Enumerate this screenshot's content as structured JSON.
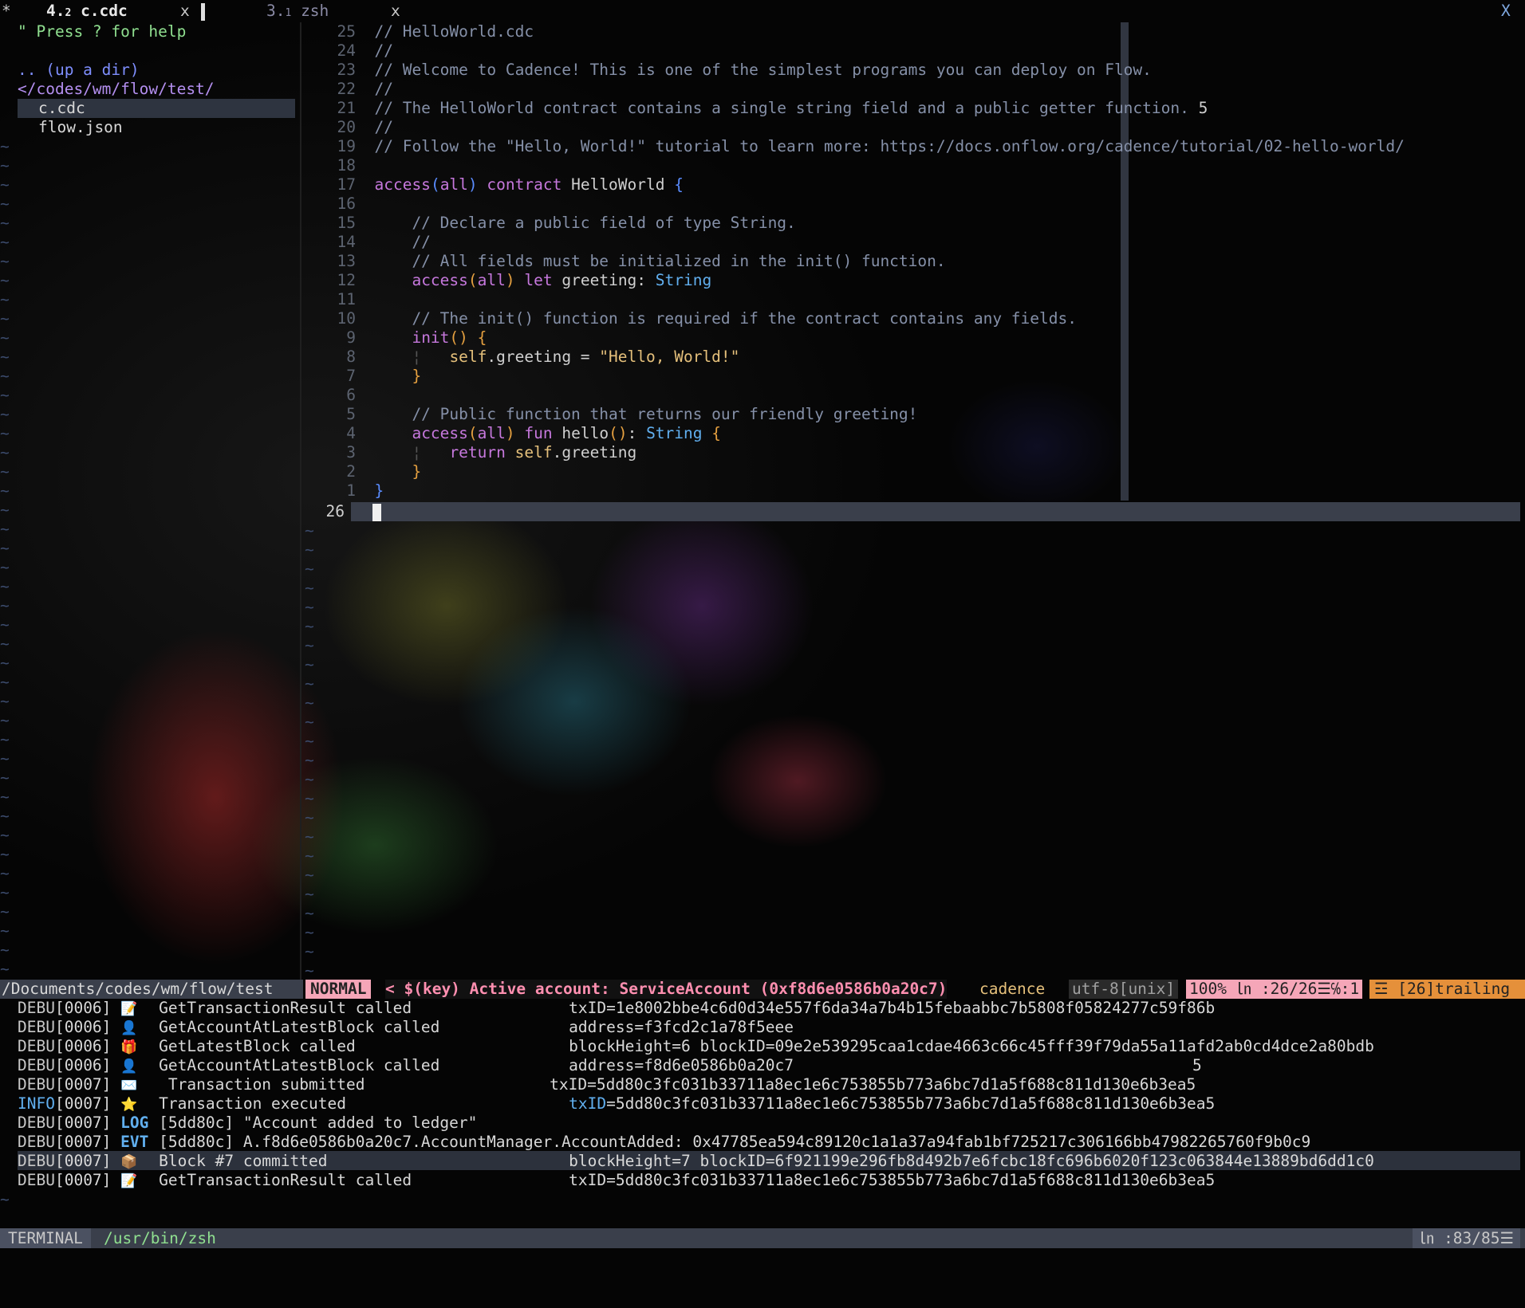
{
  "tabline": {
    "marker": "*",
    "tab1_num": "4.",
    "tab1_sub": "2",
    "tab1_name": "c.cdc",
    "tab1_close": "x",
    "tab2_num": "3.",
    "tab2_sub": "1",
    "tab2_name": "zsh",
    "tab2_close": "x",
    "close_all": "X"
  },
  "tree": {
    "help": "\" Press ? for help",
    "updir": ".. (up a dir)",
    "root": "</codes/wm/flow/test/",
    "files": [
      "c.cdc",
      "flow.json"
    ]
  },
  "editor": {
    "lines": [
      {
        "n": "25",
        "t": "// HelloWorld.cdc"
      },
      {
        "n": "24",
        "t": "//"
      },
      {
        "n": "23",
        "t": "// Welcome to Cadence! This is one of the simplest programs you can deploy on Flow."
      },
      {
        "n": "22",
        "t": "//"
      },
      {
        "n": "21",
        "t": "// The HelloWorld contract contains a single string field and a public getter function.",
        "extra": "5"
      },
      {
        "n": "20",
        "t": "//"
      },
      {
        "n": "19",
        "t": "// Follow the \"Hello, World!\" tutorial to learn more: https://docs.onflow.org/cadence/tutorial/02-hello-world/"
      },
      {
        "n": "18",
        "t": ""
      },
      {
        "n": "17"
      },
      {
        "n": "16",
        "t": ""
      },
      {
        "n": "15",
        "t": "    // Declare a public field of type String."
      },
      {
        "n": "14",
        "t": "    //"
      },
      {
        "n": "13",
        "t": "    // All fields must be initialized in the init() function."
      },
      {
        "n": "12"
      },
      {
        "n": "11",
        "t": ""
      },
      {
        "n": "10",
        "t": "    // The init() function is required if the contract contains any fields."
      },
      {
        "n": "9"
      },
      {
        "n": "8"
      },
      {
        "n": "7"
      },
      {
        "n": "6",
        "t": ""
      },
      {
        "n": "5",
        "t": "    // Public function that returns our friendly greeting!"
      },
      {
        "n": "4"
      },
      {
        "n": "3"
      },
      {
        "n": "2"
      },
      {
        "n": "1"
      },
      {
        "n": "26"
      }
    ],
    "tokens": {
      "access": "access",
      "all": "all",
      "contract": "contract",
      "name": "HelloWorld",
      "let": "let",
      "greeting_decl": "greeting:",
      "string_type": "String",
      "init": "init",
      "self": "self",
      "greeting_assign": ".greeting =",
      "hello_str": "\"Hello, World!\"",
      "fun": "fun",
      "hello": "hello",
      "return": "return",
      "greeting": ".greeting"
    }
  },
  "status": {
    "path": "/Documents/codes/wm/flow/test",
    "mode": "NORMAL",
    "message": "< $(key) Active account: ServiceAccount (0xf8d6e0586b0a20c7)",
    "filetype": "cadence",
    "encoding": "utf-8[unix]",
    "position": "100% ㏑ :26/26☰℅:1",
    "warning": "☲ [26]trailing"
  },
  "terminal": {
    "rows": [
      {
        "level": "DEBU",
        "code": "[0006]",
        "icon": "📝",
        "msg": "GetTransactionResult called",
        "kv": "txID=1e8002bbe4c6d0d34e557f6da34a7b4b15febaabbc7b5808f05824277c59f86b"
      },
      {
        "level": "DEBU",
        "code": "[0006]",
        "icon": "👤",
        "msg": "GetAccountAtLatestBlock called",
        "kv": "address=f3fcd2c1a78f5eee"
      },
      {
        "level": "DEBU",
        "code": "[0006]",
        "icon": "🎁",
        "msg": "GetLatestBlock called",
        "kv": "blockHeight=6 blockID=09e2e539295caa1cdae4663c66c45fff39f79da55a11afd2ab0cd4dce2a80bdb"
      },
      {
        "level": "DEBU",
        "code": "[0006]",
        "icon": "👤",
        "msg": "GetAccountAtLatestBlock called",
        "kv": "address=f8d6e0586b0a20c7",
        "extra": "5"
      },
      {
        "level": "DEBU",
        "code": "[0007]",
        "icon": "✉️",
        "msg": " Transaction submitted",
        "kv": "txID=5dd80c3fc031b33711a8ec1e6c753855b773a6bc7d1a5f688c811d130e6b3ea5",
        "shift": true
      },
      {
        "level": "INFO",
        "code": "[0007]",
        "icon": "⭐",
        "msg": "Transaction executed",
        "kvkey": "txID",
        "kv": "=5dd80c3fc031b33711a8ec1e6c753855b773a6bc7d1a5f688c811d130e6b3ea5"
      },
      {
        "level": "DEBU",
        "code": "[0007]",
        "tag": "LOG",
        "msg": "[5dd80c] \"Account added to ledger\""
      },
      {
        "level": "DEBU",
        "code": "[0007]",
        "tag": "EVT",
        "msg": "[5dd80c] A.f8d6e0586b0a20c7.AccountManager.AccountAdded: 0x47785ea594c89120c1a1a37a94fab1bf725217c306166bb47982265760f9b0c9"
      },
      {
        "level": "DEBU",
        "code": "[0007]",
        "icon": "📦",
        "msg": "Block #7 committed",
        "kv": "blockHeight=7 blockID=6f921199e296fb8d492b7e6fcbc18fc696b6020f123c063844e13889bd6dd1c0"
      },
      {
        "level": "DEBU",
        "code": "[0007]",
        "icon": "📝",
        "msg": "GetTransactionResult called",
        "kv": "txID=5dd80c3fc031b33711a8ec1e6c753855b773a6bc7d1a5f688c811d130e6b3ea5"
      }
    ]
  },
  "bottombar": {
    "label": "TERMINAL",
    "shell": "/usr/bin/zsh",
    "position": "㏑ :83/85☰"
  }
}
